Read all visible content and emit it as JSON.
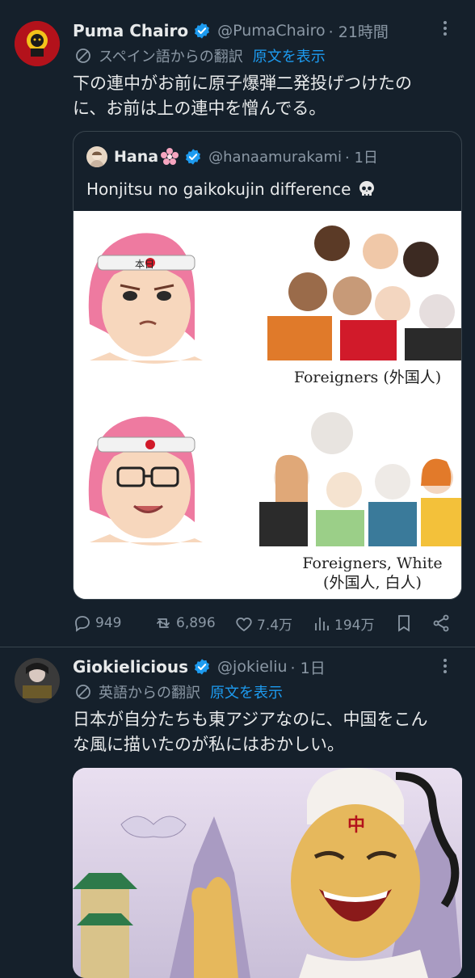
{
  "tweet1": {
    "name": "Puma Chairo",
    "handle": "@PumaChairo",
    "time": "· 21時間",
    "translate_text": "スペイン語からの翻訳",
    "translate_link": "原文を表示",
    "body_line1": "下の連中がお前に原子爆弾二発投げつけたの",
    "body_line2": "に、お前は上の連中を憎んでる。",
    "quote": {
      "name": "Hana",
      "handle": "@hanaamurakami",
      "time": "· 1日",
      "text": "Honjitsu no gaikokujin difference",
      "image": {
        "headband_text": "本日",
        "caption_top": "Foreigners (外国人)",
        "caption_bottom_1": "Foreigners, White",
        "caption_bottom_2": "(外国人, 白人)"
      }
    },
    "actions": {
      "replies": "949",
      "retweets": "6,896",
      "likes": "7.4万",
      "views": "194万"
    }
  },
  "tweet2": {
    "name": "Giokielicious",
    "handle": "@jokieliu",
    "time": "· 1日",
    "translate_text": "英語からの翻訳",
    "translate_link": "原文を表示",
    "body_line1": "日本が自分たちも東アジアなのに、中国をこん",
    "body_line2": "な風に描いたのが私にはおかしい。",
    "image_text": "中"
  },
  "colors": {
    "background": "#15202b",
    "text": "#e7e9ea",
    "muted": "#8b98a5",
    "link": "#1d9bf0",
    "border": "#38444d"
  }
}
